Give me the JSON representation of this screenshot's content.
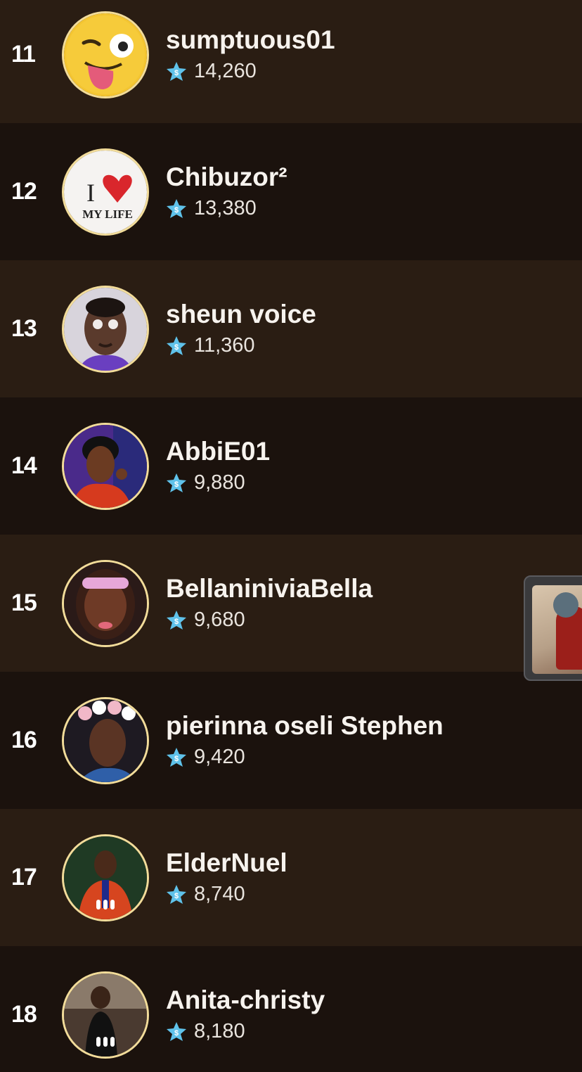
{
  "leaderboard": {
    "rows": [
      {
        "rank": "11",
        "name": "sumptuous01",
        "score": "14,260"
      },
      {
        "rank": "12",
        "name": "Chibuzor²",
        "score": "13,380"
      },
      {
        "rank": "13",
        "name": "sheun voice",
        "score": "11,360"
      },
      {
        "rank": "14",
        "name": "AbbiE01",
        "score": "9,880"
      },
      {
        "rank": "15",
        "name": "BellaniniviaBella",
        "score": "9,680"
      },
      {
        "rank": "16",
        "name": "pierinna oseli Stephen",
        "score": "9,420"
      },
      {
        "rank": "17",
        "name": "ElderNuel",
        "score": "8,740"
      },
      {
        "rank": "18",
        "name": "Anita-christy",
        "score": "8,180"
      }
    ],
    "avatar_12_text_top": "I",
    "avatar_12_text_bottom": "MY LIFE",
    "score_icon": "star-coin-icon",
    "colors": {
      "row_light": "#2a1d13",
      "row_dark": "#1b120d",
      "avatar_border": "#f2dc9a",
      "star": "#5fc2ea"
    }
  }
}
